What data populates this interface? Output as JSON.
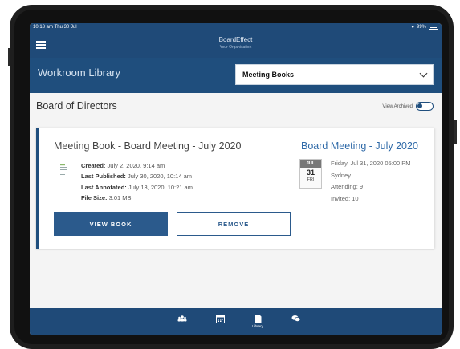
{
  "status_bar": {
    "time": "10:18 am",
    "date": "Thu 30 Jul",
    "battery": "99%"
  },
  "header": {
    "app_name": "BoardEffect",
    "organisation": "Your Organisation"
  },
  "library_bar": {
    "title": "Workroom Library",
    "dropdown_value": "Meeting Books"
  },
  "board": {
    "title": "Board of Directors",
    "view_archived_label": "View Archived",
    "view_archived_on": true
  },
  "book": {
    "title": "Meeting Book - Board Meeting - July 2020",
    "created_label": "Created:",
    "created_value": "July 2, 2020, 9:14 am",
    "published_label": "Last Published:",
    "published_value": "July 30, 2020, 10:14 am",
    "annotated_label": "Last Annotated:",
    "annotated_value": "July 13, 2020, 10:21 am",
    "size_label": "File Size:",
    "size_value": "3.01 MB",
    "view_label": "VIEW BOOK",
    "remove_label": "REMOVE"
  },
  "meeting": {
    "title": "Board Meeting - July 2020",
    "cal_month": "JUL",
    "cal_day": "31",
    "cal_weekday": "FRI",
    "datetime": "Friday, Jul 31, 2020 05:00 PM",
    "location": "Sydney",
    "attending": "Attending: 9",
    "invited": "Invited: 10"
  },
  "tabs": {
    "library_label": "Library"
  },
  "colors": {
    "brand": "#1f4a78",
    "button": "#2b5a8c",
    "link": "#2f6aa8"
  }
}
